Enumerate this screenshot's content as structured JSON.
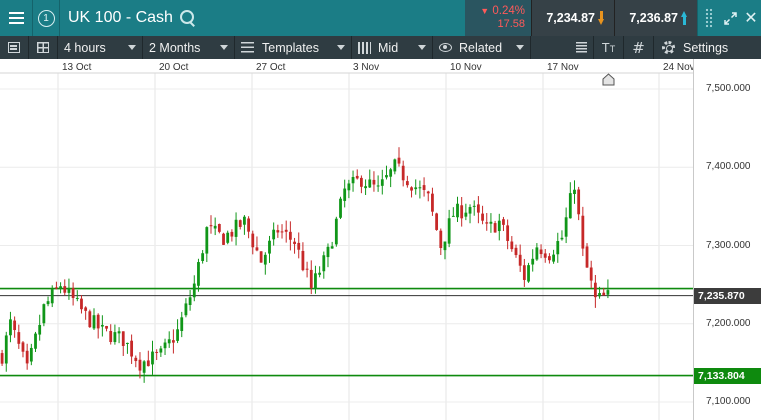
{
  "header": {
    "info_label": "1",
    "title": "UK 100 - Cash",
    "change_pct": "0.24%",
    "change_abs": "17.58",
    "sell_price": "7,234.87",
    "buy_price": "7,236.87"
  },
  "toolbar": {
    "interval": "4 hours",
    "range": "2 Months",
    "templates": "Templates",
    "price_type": "Mid",
    "related": "Related",
    "settings": "Settings"
  },
  "colors": {
    "header": "#1b7d86",
    "toolbar": "#2f3c42",
    "up_candle": "#109618",
    "down_candle": "#c62828",
    "level_line": "#0e8a0e",
    "change_negative": "#ff5a5a"
  },
  "chart_data": {
    "type": "candlestick",
    "x_ticks": [
      "13 Oct",
      "20 Oct",
      "27 Oct",
      "3 Nov",
      "10 Nov",
      "17 Nov",
      "24 Nov"
    ],
    "y_ticks": [
      "7,500.000",
      "7,400.000",
      "7,300.000",
      "7,200.000",
      "7,100.000"
    ],
    "ylim": [
      7080,
      7620
    ],
    "grid": true,
    "current_price": "7,235.870",
    "horizontal_levels": [
      {
        "value": 7245,
        "label": ""
      },
      {
        "value": 7133.804,
        "label": "7,133.804"
      }
    ],
    "anchors": [
      {
        "x": 0,
        "y": 7160
      },
      {
        "x": 2,
        "y": 7200
      },
      {
        "x": 6,
        "y": 7140
      },
      {
        "x": 10,
        "y": 7220
      },
      {
        "x": 14,
        "y": 7250
      },
      {
        "x": 20,
        "y": 7210
      },
      {
        "x": 24,
        "y": 7190
      },
      {
        "x": 29,
        "y": 7180
      },
      {
        "x": 33,
        "y": 7150
      },
      {
        "x": 38,
        "y": 7160
      },
      {
        "x": 42,
        "y": 7190
      },
      {
        "x": 46,
        "y": 7250
      },
      {
        "x": 49,
        "y": 7320
      },
      {
        "x": 53,
        "y": 7310
      },
      {
        "x": 58,
        "y": 7330
      },
      {
        "x": 62,
        "y": 7280
      },
      {
        "x": 66,
        "y": 7320
      },
      {
        "x": 70,
        "y": 7305
      },
      {
        "x": 74,
        "y": 7245
      },
      {
        "x": 78,
        "y": 7290
      },
      {
        "x": 82,
        "y": 7370
      },
      {
        "x": 86,
        "y": 7385
      },
      {
        "x": 90,
        "y": 7370
      },
      {
        "x": 94,
        "y": 7400
      },
      {
        "x": 98,
        "y": 7380
      },
      {
        "x": 102,
        "y": 7360
      },
      {
        "x": 105,
        "y": 7300
      },
      {
        "x": 108,
        "y": 7340
      },
      {
        "x": 112,
        "y": 7350
      },
      {
        "x": 116,
        "y": 7320
      },
      {
        "x": 119,
        "y": 7330
      },
      {
        "x": 122,
        "y": 7295
      },
      {
        "x": 125,
        "y": 7260
      },
      {
        "x": 128,
        "y": 7300
      },
      {
        "x": 131,
        "y": 7290
      },
      {
        "x": 134,
        "y": 7310
      },
      {
        "x": 137,
        "y": 7380
      },
      {
        "x": 139,
        "y": 7290
      },
      {
        "x": 142,
        "y": 7230
      },
      {
        "x": 145,
        "y": 7235
      }
    ],
    "candle_count": 146
  }
}
